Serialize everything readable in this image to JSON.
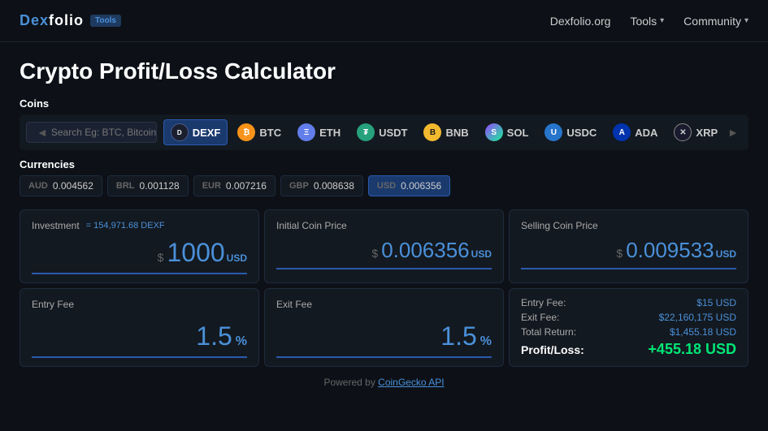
{
  "nav": {
    "logo": "Dexfolio",
    "logo_accent": "Dex",
    "badge": "Tools",
    "links": [
      {
        "label": "Dexfolio.org",
        "has_chevron": false
      },
      {
        "label": "Tools",
        "has_chevron": true
      },
      {
        "label": "Community",
        "has_chevron": true
      }
    ]
  },
  "page": {
    "title": "Crypto Profit/Loss Calculator"
  },
  "coins_section": {
    "label": "Coins",
    "search_placeholder": "Search Eg: BTC, Bitcoin, etc.",
    "coins": [
      {
        "symbol": "DEXF",
        "icon_class": "dexf",
        "icon_text": "D",
        "active": true
      },
      {
        "symbol": "BTC",
        "icon_class": "btc",
        "icon_text": "₿"
      },
      {
        "symbol": "ETH",
        "icon_class": "eth",
        "icon_text": "Ξ"
      },
      {
        "symbol": "USDT",
        "icon_class": "usdt",
        "icon_text": "₮"
      },
      {
        "symbol": "BNB",
        "icon_class": "bnb",
        "icon_text": "B"
      },
      {
        "symbol": "SOL",
        "icon_class": "sol",
        "icon_text": "S"
      },
      {
        "symbol": "USDC",
        "icon_class": "usdc",
        "icon_text": "U"
      },
      {
        "symbol": "ADA",
        "icon_class": "ada",
        "icon_text": "A"
      },
      {
        "symbol": "XRP",
        "icon_class": "xrp",
        "icon_text": "✕"
      }
    ]
  },
  "currencies_section": {
    "label": "Currencies",
    "currencies": [
      {
        "code": "AUD",
        "value": "0.004562",
        "active": false
      },
      {
        "code": "BRL",
        "value": "0.001128",
        "active": false
      },
      {
        "code": "EUR",
        "value": "0.007216",
        "active": false
      },
      {
        "code": "GBP",
        "value": "0.008638",
        "active": false
      },
      {
        "code": "USD",
        "value": "0.006356",
        "active": true
      }
    ]
  },
  "investment_card": {
    "label": "Investment",
    "sublabel": "= 154,971.68 DEXF",
    "dollar_sign": "$",
    "value": "1000",
    "unit": "USD"
  },
  "initial_coin_price_card": {
    "label": "Initial Coin Price",
    "dollar_sign": "$",
    "value": "0.006356",
    "unit": "USD"
  },
  "selling_coin_price_card": {
    "label": "Selling Coin Price",
    "dollar_sign": "$",
    "value": "0.009533",
    "unit": "USD"
  },
  "entry_fee_card": {
    "label": "Entry Fee",
    "value": "1.5",
    "unit": "%"
  },
  "exit_fee_card": {
    "label": "Exit Fee",
    "value": "1.5",
    "unit": "%"
  },
  "result_card": {
    "entry_fee_label": "Entry Fee:",
    "entry_fee_value": "$15 USD",
    "exit_fee_label": "Exit Fee:",
    "exit_fee_value": "$22,160,175 USD",
    "total_return_label": "Total Return:",
    "total_return_value": "$1,455.18 USD",
    "profit_loss_label": "Profit/Loss:",
    "profit_loss_value": "+455.18 USD"
  },
  "footer": {
    "text": "Powered by ",
    "link_text": "CoinGecko API"
  }
}
